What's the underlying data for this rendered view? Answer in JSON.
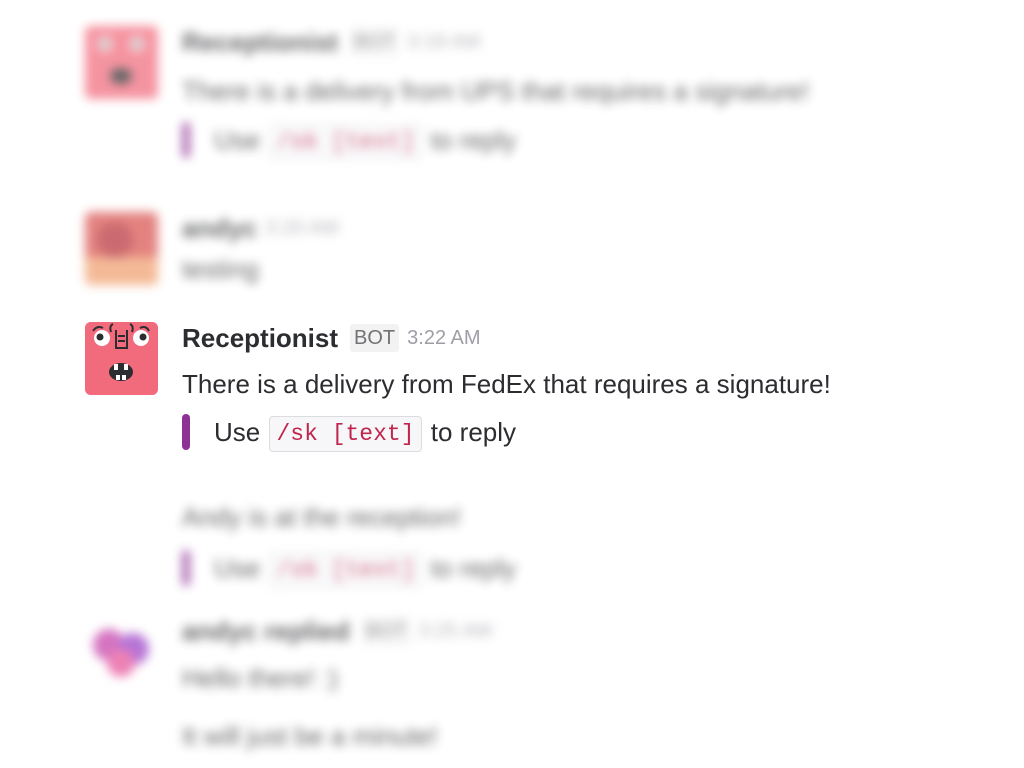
{
  "messages": [
    {
      "author": "Receptionist",
      "badge": "BOT",
      "time": "3:18 AM",
      "text": "There is a delivery from UPS that requires a signature!",
      "attachment": {
        "prefix": "Use",
        "code": "/sk [text]",
        "suffix": "to reply"
      }
    },
    {
      "author": "andyc",
      "time": "3:20 AM",
      "text": "testing"
    },
    {
      "author": "Receptionist",
      "badge": "BOT",
      "time": "3:22 AM",
      "text": "There is a delivery from FedEx that requires a signature!",
      "attachment": {
        "prefix": "Use",
        "code": "/sk [text]",
        "suffix": "to reply"
      }
    },
    {
      "text": "Andy is at the reception!",
      "attachment": {
        "prefix": "Use",
        "code": "/sk [text]",
        "suffix": "to reply"
      }
    },
    {
      "author": "andyc replied",
      "badge": "BOT",
      "time": "3:25 AM",
      "lines": [
        "Hello there! :)",
        "It will just be a minute!"
      ]
    }
  ],
  "colors": {
    "attachment_bar": "#8e3296",
    "code_text": "#c0264d",
    "avatar_pink": "#f26b7d"
  },
  "icons": {
    "receptionist_avatar": "robot-face-icon",
    "andyc_avatar": "user-photo-icon",
    "reply_avatar": "hearts-icon"
  }
}
